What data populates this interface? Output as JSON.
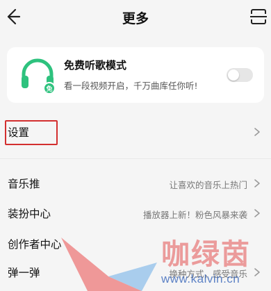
{
  "header": {
    "title": "更多",
    "back_icon": "arrow-left-icon",
    "scan_icon": "scan-icon"
  },
  "free_mode": {
    "title": "免费听歌模式",
    "subtitle": "看一段视频开启，千万曲库任你听!",
    "badge": "免",
    "icon": "headphones-icon",
    "accent_color": "#2ec27e",
    "toggle_on": false
  },
  "rows": [
    {
      "label": "设置",
      "value": ""
    },
    {
      "label": "音乐推",
      "value": "让喜欢的音乐上热门"
    },
    {
      "label": "装扮中心",
      "value": "播放器上新！粉色风暴来袭"
    },
    {
      "label": "创作者中心",
      "value": ""
    },
    {
      "label": "弹一弹",
      "value": "换种方式，感受音乐"
    }
  ],
  "watermark": {
    "text": "咖绿茵",
    "url": "www.kalvin.cn"
  },
  "colors": {
    "highlight": "#d32f2f",
    "background": "#f5f5f5"
  }
}
